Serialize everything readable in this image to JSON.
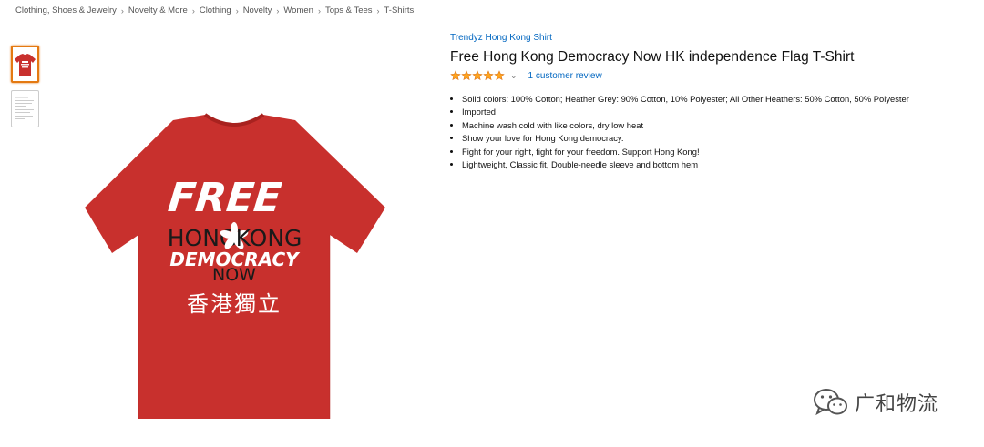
{
  "breadcrumb": [
    "Clothing, Shoes & Jewelry",
    "Novelty & More",
    "Clothing",
    "Novelty",
    "Women",
    "Tops & Tees",
    "T-Shirts"
  ],
  "breadcrumb_separator": "›",
  "product": {
    "brand": "Trendyz Hong Kong Shirt",
    "title": "Free Hong Kong Democracy Now HK independence Flag T-Shirt",
    "rating_stars": 5,
    "rating_max": 5,
    "rating_chevron": "⌄",
    "reviews_text": "1 customer review",
    "bullets": [
      "Solid colors: 100% Cotton; Heather Grey: 90% Cotton, 10% Polyester; All Other Heathers: 50% Cotton, 50% Polyester",
      "Imported",
      "Machine wash cold with like colors, dry low heat",
      "Show your love for Hong Kong democracy.",
      "Fight for your right, fight for your freedom. Support Hong Kong!",
      "Lightweight, Classic fit, Double-needle sleeve and bottom hem"
    ]
  },
  "shirt_print": {
    "line1": "FREE",
    "line2a": "HONG",
    "line2b": "KONG",
    "line3": "DEMOCRACY",
    "line4": "NOW",
    "line5": "香港獨立"
  },
  "colors": {
    "shirt": "#c8302d",
    "link": "#0066c0",
    "star": "#ffa41c",
    "active_thumb_border": "#e47911"
  },
  "icons": {
    "thumb1": "tshirt-thumbnail",
    "thumb2": "detail-thumbnail",
    "star": "star-icon",
    "watermark": "wechat-icon"
  },
  "watermark": {
    "text": "广和物流"
  }
}
